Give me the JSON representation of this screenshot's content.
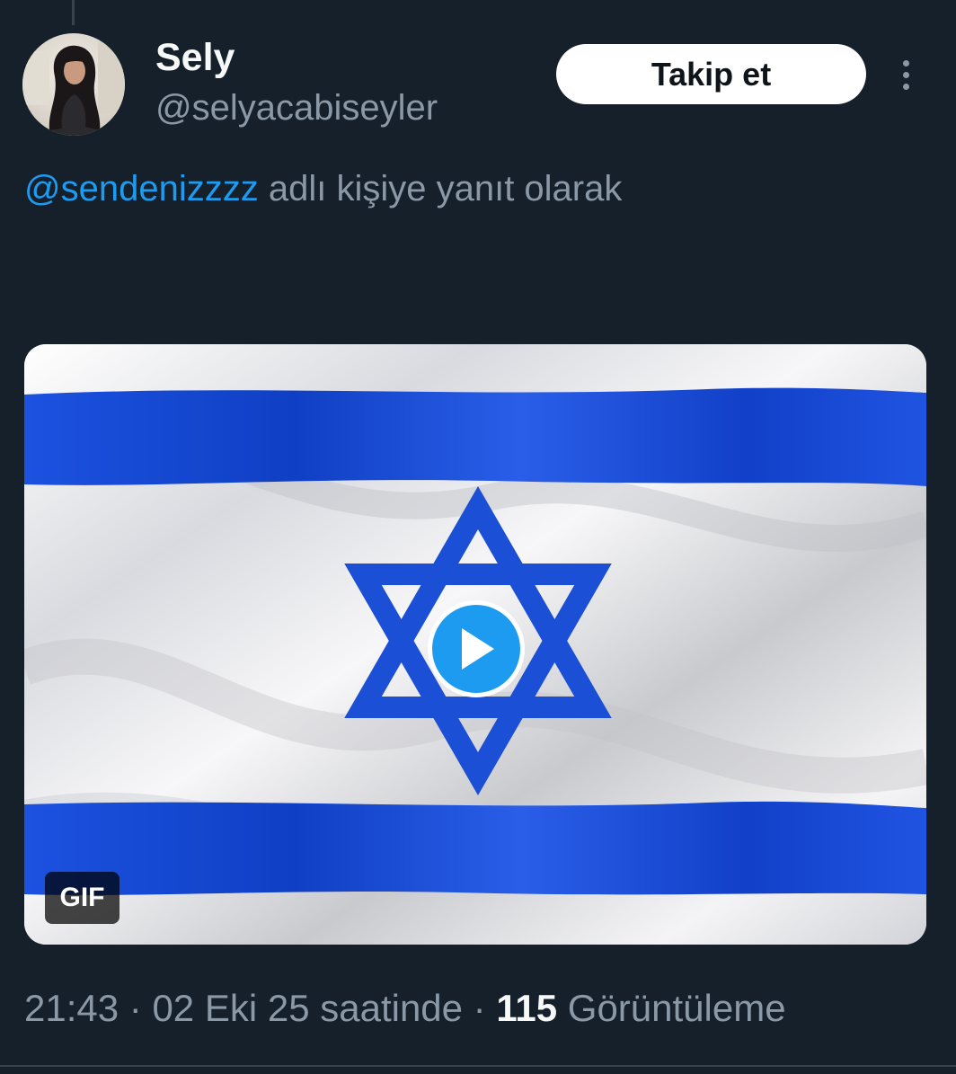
{
  "tweet": {
    "author": {
      "display_name": "Sely",
      "handle": "@selyacabiseyler"
    },
    "follow_label": "Takip et",
    "reply_context": {
      "mention": "@sendenizzzz",
      "suffix": " adlı kişiye yanıt olarak"
    },
    "media": {
      "badge": "GIF",
      "icons": [
        "play-icon"
      ]
    },
    "meta": {
      "time": "21:43",
      "separator1": " · ",
      "date_text": "02 Eki 25 saatinde",
      "separator2": " · ",
      "views_count": "115",
      "views_label": " Görüntüleme"
    }
  },
  "colors": {
    "background": "#15202b",
    "accent": "#1d9bf0",
    "secondary_text": "#8b98a5",
    "flag_blue": "#1a4fd6",
    "flag_white": "#f2f2f4"
  }
}
